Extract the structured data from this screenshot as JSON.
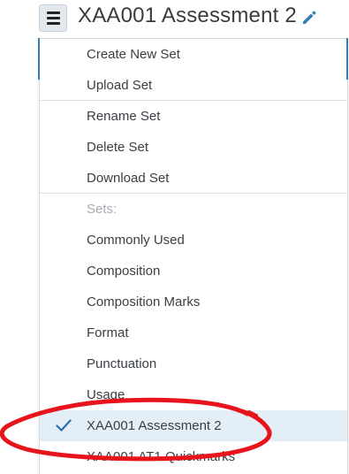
{
  "header": {
    "title": "XAA001 Assessment 2",
    "menu_icon": "hamburger-menu-icon",
    "edit_icon": "pencil-icon"
  },
  "menu": {
    "actions": [
      "Create New Set",
      "Upload Set"
    ],
    "manage": [
      "Rename Set",
      "Delete Set",
      "Download Set"
    ],
    "sets_heading": "Sets:",
    "sets": [
      "Commonly Used",
      "Composition",
      "Composition Marks",
      "Format",
      "Punctuation",
      "Usage",
      "XAA001 Assessment 2",
      "XAA001 AT1 Quickmarks"
    ],
    "selected_set": "XAA001 Assessment 2"
  },
  "colors": {
    "accent": "#2e7fb3",
    "selected_bg": "#e4eef6",
    "check": "#2a6fa8",
    "annotation": "#e8141c",
    "heading_text": "#a7adb3"
  }
}
